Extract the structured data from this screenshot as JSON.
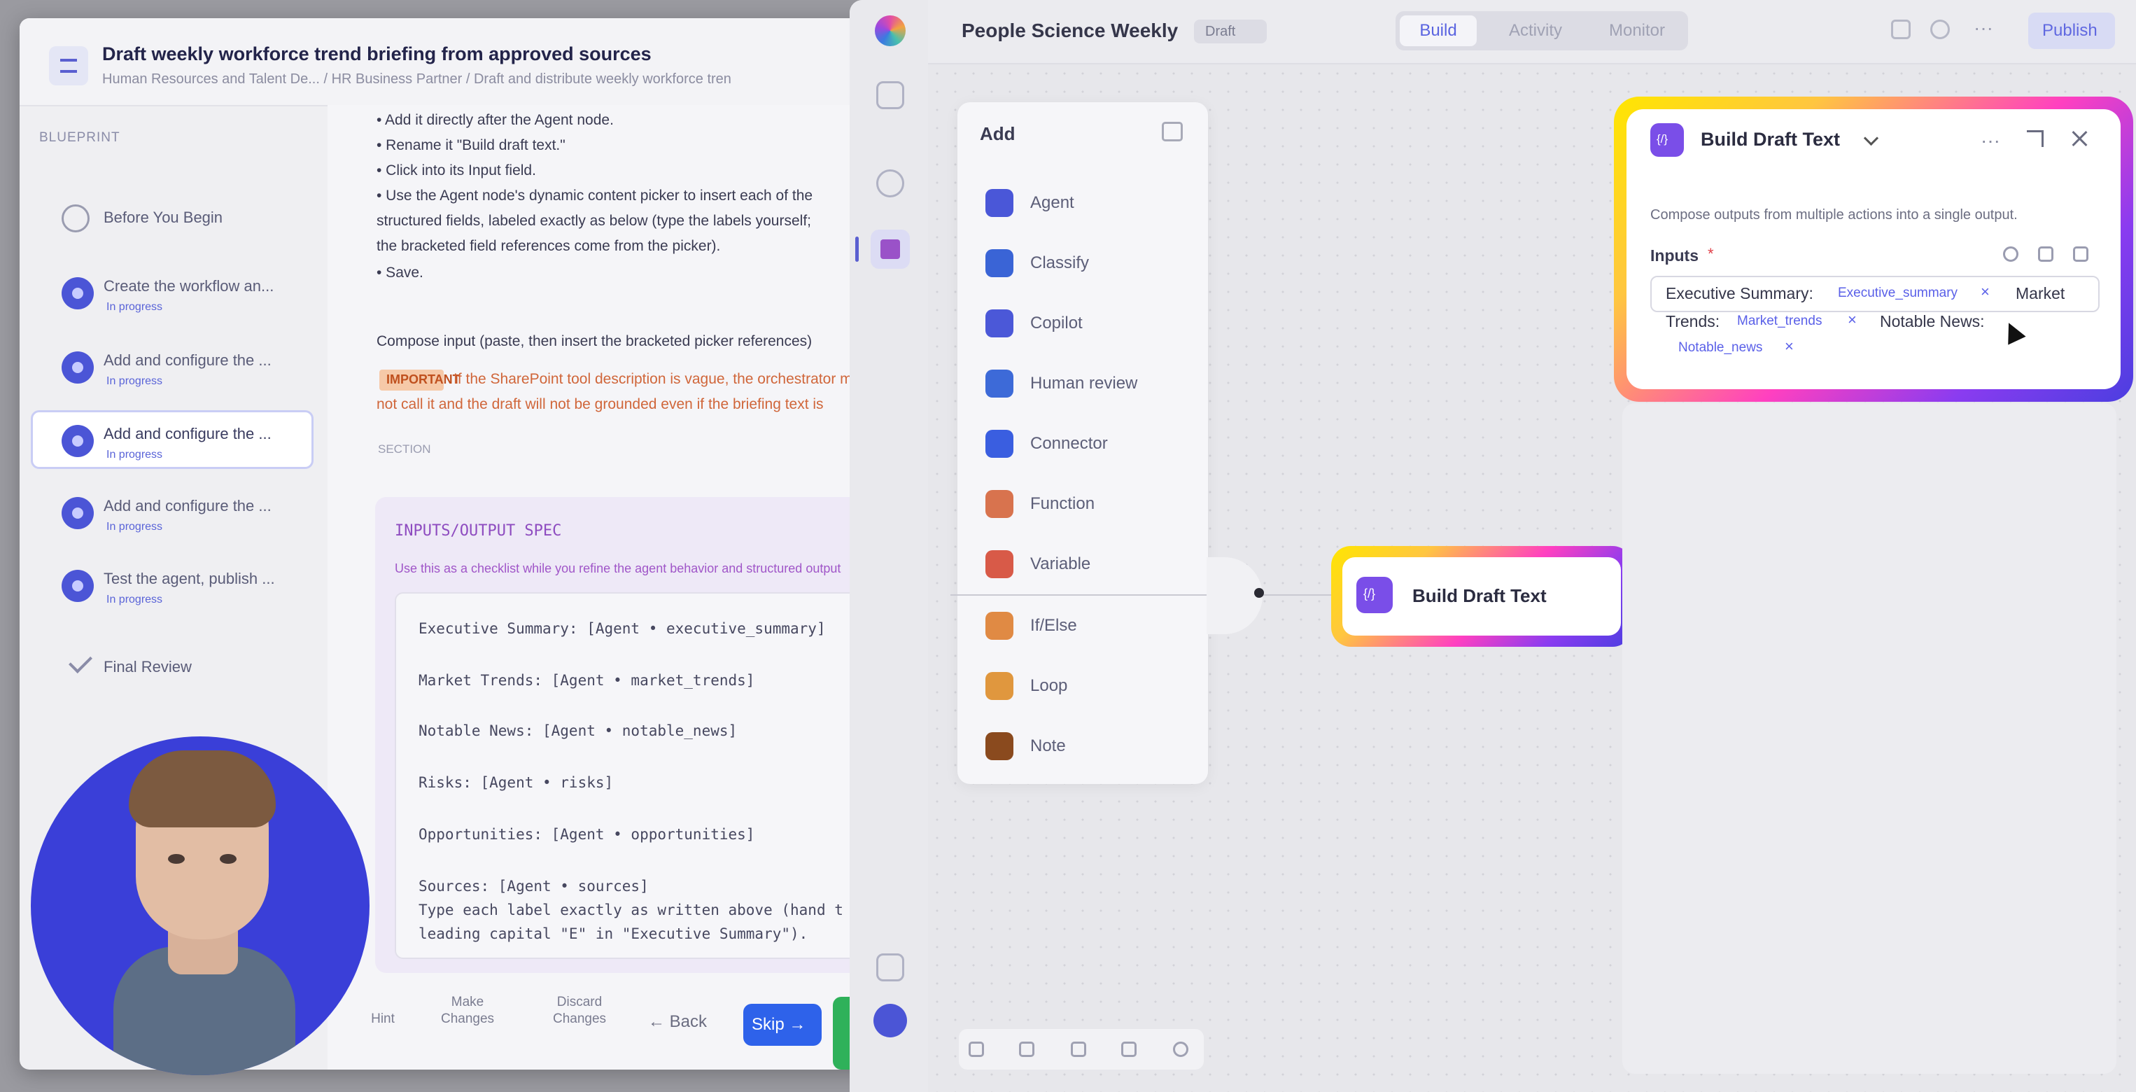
{
  "guide": {
    "title": "Draft weekly workforce trend briefing from approved sources",
    "breadcrumb": "Human Resources and Talent De... / HR Business Partner / Draft and distribute weekly workforce tren",
    "blueprint_label": "BLUEPRINT",
    "steps": [
      {
        "title": "Before You Begin",
        "progress": ""
      },
      {
        "title": "Create the workflow an...",
        "progress": "In progress"
      },
      {
        "title": "Add and configure the ...",
        "progress": "In progress"
      },
      {
        "title": "Add and configure the ...",
        "progress": "In progress"
      },
      {
        "title": "Add and configure the ...",
        "progress": "In progress"
      },
      {
        "title": "Test the agent, publish ...",
        "progress": "In progress"
      },
      {
        "title": "Final Review",
        "progress": ""
      }
    ],
    "bullets": [
      "• Add it directly after the Agent node.",
      "• Rename it \"Build draft text.\"",
      "• Click into its Input field.",
      "• Use the Agent node's dynamic content picker to insert each of the",
      "structured fields, labeled exactly as below (type the labels yourself;",
      "the bracketed field references come from the picker).",
      "• Save."
    ],
    "compose_line": "Compose input (paste, then insert the bracketed picker references)",
    "important": "IMPORTANT",
    "warning_1": "If the SharePoint tool description is vague, the orchestrator may",
    "warning_2": "not call it and the draft will not be grounded even if the briefing text is",
    "section_tag": "SECTION",
    "ref_title": "INPUTS/OUTPUT SPEC",
    "ref_desc": "Use this as a checklist while you refine the agent behavior and structured output",
    "code_lines": [
      "Executive Summary: [Agent • executive_summary]",
      "Market Trends: [Agent • market_trends]",
      "Notable News: [Agent • notable_news]",
      "Risks: [Agent • risks]",
      "Opportunities: [Agent • opportunities]",
      "Sources: [Agent • sources]",
      "Type each label exactly as written above (hand t",
      "leading capital \"E\" in \"Executive Summary\")."
    ],
    "footer": {
      "hint": "Hint",
      "make_changes": "Make Changes",
      "discard_changes": "Discard Changes",
      "back": "← Back",
      "skip": "Skip →"
    }
  },
  "app": {
    "project_title": "People Science Weekly",
    "status_badge": "Draft",
    "tabs": [
      "Build",
      "Activity",
      "Monitor"
    ],
    "publish": "Publish",
    "add_panel": {
      "title": "Add",
      "items": [
        {
          "label": "Agent",
          "color": "#4a57d8"
        },
        {
          "label": "Classify",
          "color": "#3a64d6"
        },
        {
          "label": "Copilot",
          "color": "#4b58d8"
        },
        {
          "label": "Human review",
          "color": "#3d6ad8"
        },
        {
          "label": "Connector",
          "color": "#3a5ee0"
        },
        {
          "label": "Function",
          "color": "#d8734e"
        },
        {
          "label": "Variable",
          "color": "#d85a48"
        },
        {
          "label": "If/Else",
          "color": "#e08a44"
        },
        {
          "label": "Loop",
          "color": "#e0973e"
        },
        {
          "label": "Note",
          "color": "#8a4a1e"
        }
      ]
    },
    "node": {
      "label": "Build Draft Text"
    },
    "config": {
      "title": "Build Draft Text",
      "description": "Compose outputs from multiple actions into a single output.",
      "inputs_label": "Inputs",
      "required_mark": "*",
      "line1_label": "Executive Summary:",
      "pill1": "Executive_summary",
      "line1_tail": "Market",
      "line2_label": "Trends:",
      "pill2": "Market_trends",
      "line2_tail": "Notable News:",
      "pill3": "Notable_news",
      "remove": "×"
    }
  }
}
